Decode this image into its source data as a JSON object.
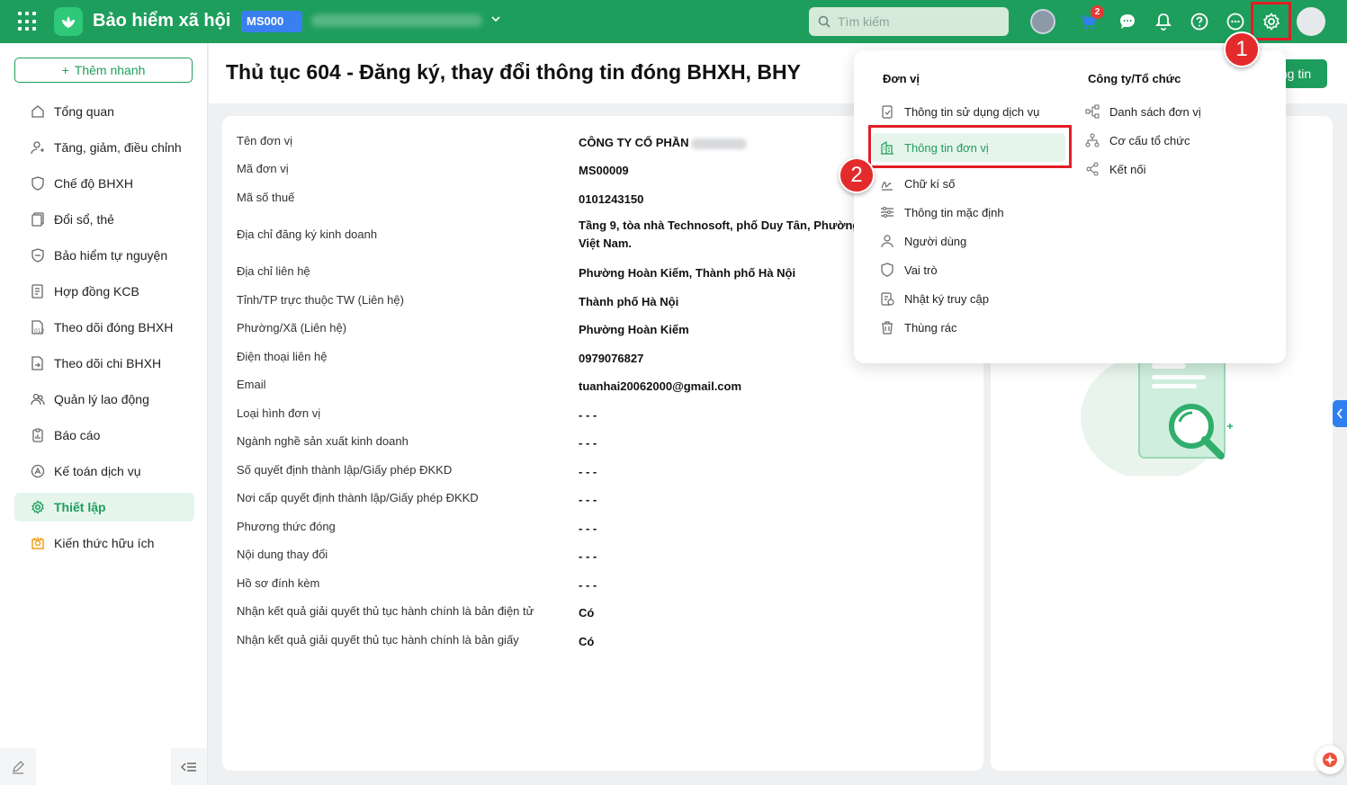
{
  "topbar": {
    "app_title": "Bảo hiểm xã hội",
    "unit_code": "MS000",
    "unit_name": "CÔNG TY CỔ PHẦN",
    "search_placeholder": "Tìm kiếm",
    "cart_badge": "2",
    "brand_color": "#1e9e5c"
  },
  "sidebar": {
    "quick_add": "Thêm nhanh",
    "items": [
      {
        "label": "Tổng quan",
        "icon": "home-icon"
      },
      {
        "label": "Tăng, giảm, điều chỉnh",
        "icon": "user-adjust-icon"
      },
      {
        "label": "Chế độ BHXH",
        "icon": "shield-heart-icon"
      },
      {
        "label": "Đổi sổ, thẻ",
        "icon": "card-swap-icon"
      },
      {
        "label": "Bảo hiểm tự nguyện",
        "icon": "shield-icon"
      },
      {
        "label": "Hợp đồng KCB",
        "icon": "contract-icon"
      },
      {
        "label": "Theo dõi đóng BHXH",
        "icon": "ledger-icon"
      },
      {
        "label": "Theo dõi chi BHXH",
        "icon": "payout-icon"
      },
      {
        "label": "Quản lý lao động",
        "icon": "team-icon"
      },
      {
        "label": "Báo cáo",
        "icon": "report-icon"
      },
      {
        "label": "Kế toán dịch vụ",
        "icon": "accounting-icon"
      },
      {
        "label": "Thiết lập",
        "icon": "gear-icon"
      },
      {
        "label": "Kiến thức hữu ích",
        "icon": "knowledge-icon"
      }
    ]
  },
  "header": {
    "title": "Thủ tục 604 - Đăng ký, thay đổi thông tin đóng BHXH, BHY",
    "update_button": "ng tin"
  },
  "details": [
    {
      "label": "Tên đơn vị",
      "value": "CÔNG TY CỔ PHẦN"
    },
    {
      "label": "Mã đơn vị",
      "value": "MS00009"
    },
    {
      "label": "Mã số thuế",
      "value": "0101243150"
    },
    {
      "label": "Địa chỉ đăng ký kinh doanh",
      "value": "Tầng 9, tòa nhà Technosoft, phố Duy Tân, Phường C",
      "value2": "Việt Nam."
    },
    {
      "label": "Địa chỉ liên hệ",
      "value": "Phường Hoàn Kiếm, Thành phố Hà Nội"
    },
    {
      "label": "Tỉnh/TP trực thuộc TW (Liên hệ)",
      "value": "Thành phố Hà Nội"
    },
    {
      "label": "Phường/Xã (Liên hệ)",
      "value": "Phường Hoàn Kiếm"
    },
    {
      "label": "Điện thoại liên hệ",
      "value": "0979076827"
    },
    {
      "label": "Email",
      "value": "tuanhai20062000@gmail.com"
    },
    {
      "label": "Loại hình đơn vị",
      "value": "- - -"
    },
    {
      "label": "Ngành nghề sản xuất kinh doanh",
      "value": "- - -"
    },
    {
      "label": "Số quyết định thành lập/Giấy phép ĐKKD",
      "value": "- - -"
    },
    {
      "label": "Nơi cấp quyết định thành lập/Giấy phép ĐKKD",
      "value": "- - -"
    },
    {
      "label": "Phương thức đóng",
      "value": "- - -"
    },
    {
      "label": "Nội dung thay đổi",
      "value": "- - -"
    },
    {
      "label": "Hồ sơ đính kèm",
      "value": "- - -"
    },
    {
      "label": "Nhận kết quả giải quyết thủ tục hành chính là bản điện tử",
      "value": "Có"
    },
    {
      "label": "Nhận kết quả giải quyết thủ tục hành chính là bản giấy",
      "value": "Có"
    }
  ],
  "dropdown": {
    "col1_title": "Đơn vị",
    "col1_items": [
      {
        "label": "Thông tin sử dụng dịch vụ",
        "icon": "clipboard-check-icon"
      },
      {
        "label": "Thông tin đơn vị",
        "icon": "building-icon"
      },
      {
        "label": "Chữ kí số",
        "icon": "signature-icon"
      },
      {
        "label": "Thông tin mặc định",
        "icon": "sliders-icon"
      },
      {
        "label": "Người dùng",
        "icon": "user-icon"
      },
      {
        "label": "Vai trò",
        "icon": "shield-outline-icon"
      },
      {
        "label": "Nhật ký truy cập",
        "icon": "access-log-icon"
      },
      {
        "label": "Thùng rác",
        "icon": "trash-icon"
      }
    ],
    "col2_title": "Công ty/Tổ chức",
    "col2_items": [
      {
        "label": "Danh sách đơn vị",
        "icon": "unit-list-icon"
      },
      {
        "label": "Cơ cấu tổ chức",
        "icon": "org-chart-icon"
      },
      {
        "label": "Kết nối",
        "icon": "share-icon"
      }
    ]
  },
  "markers": {
    "step1": "1",
    "step2": "2"
  }
}
